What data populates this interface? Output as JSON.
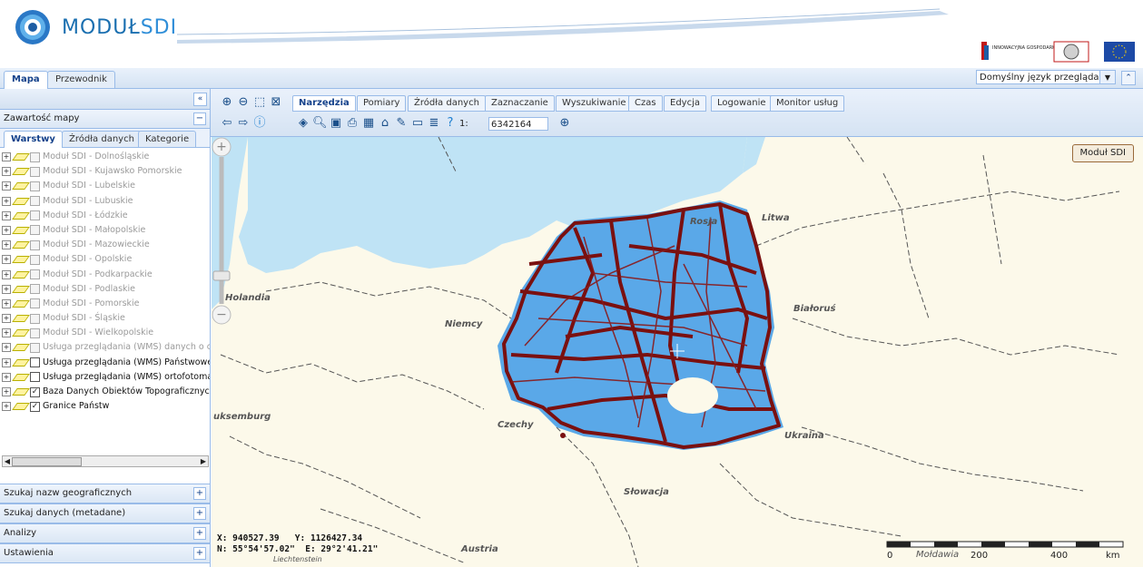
{
  "header": {
    "logo_text_a": "MODUŁ",
    "logo_text_b": "SDI",
    "eu_text": "INNOWACYJNA GOSPODARKA"
  },
  "top_tabs": [
    {
      "label": "Mapa",
      "active": true
    },
    {
      "label": "Przewodnik",
      "active": false
    }
  ],
  "language_select": {
    "value": "Domyślny język przeglądarki"
  },
  "left_panel": {
    "map_contents_title": "Zawartość mapy",
    "subtabs": [
      {
        "label": "Warstwy",
        "active": true
      },
      {
        "label": "Źródła danych",
        "active": false
      },
      {
        "label": "Kategorie",
        "active": false
      }
    ],
    "layers": [
      {
        "label": "Moduł SDI - Dolnośląskie",
        "checked": false,
        "dark": false
      },
      {
        "label": "Moduł SDI - Kujawsko Pomorskie",
        "checked": false,
        "dark": false
      },
      {
        "label": "Moduł SDI - Lubelskie",
        "checked": false,
        "dark": false
      },
      {
        "label": "Moduł SDI - Lubuskie",
        "checked": false,
        "dark": false
      },
      {
        "label": "Moduł SDI - Łódzkie",
        "checked": false,
        "dark": false
      },
      {
        "label": "Moduł SDI - Małopolskie",
        "checked": false,
        "dark": false
      },
      {
        "label": "Moduł SDI - Mazowieckie",
        "checked": false,
        "dark": false
      },
      {
        "label": "Moduł SDI - Opolskie",
        "checked": false,
        "dark": false
      },
      {
        "label": "Moduł SDI - Podkarpackie",
        "checked": false,
        "dark": false
      },
      {
        "label": "Moduł SDI - Podlaskie",
        "checked": false,
        "dark": false
      },
      {
        "label": "Moduł SDI - Pomorskie",
        "checked": false,
        "dark": false
      },
      {
        "label": "Moduł SDI - Śląskie",
        "checked": false,
        "dark": false
      },
      {
        "label": "Moduł SDI - Wielkopolskie",
        "checked": false,
        "dark": false
      },
      {
        "label": "Usługa przeglądania (WMS) danych o ch",
        "checked": false,
        "dark": false
      },
      {
        "label": "Usługa przeglądania (WMS) Państwowe",
        "checked": false,
        "dark": true
      },
      {
        "label": "Usługa przeglądania (WMS) ortofotomap",
        "checked": false,
        "dark": true
      },
      {
        "label": "Baza Danych Obiektów Topograficznych",
        "checked": true,
        "dark": true
      },
      {
        "label": "Granice Państw",
        "checked": true,
        "dark": true
      }
    ],
    "accordion": [
      {
        "label": "Szukaj nazw geograficznych"
      },
      {
        "label": "Szukaj danych (metadane)"
      },
      {
        "label": "Analizy"
      },
      {
        "label": "Ustawienia"
      }
    ]
  },
  "map_tabs": [
    {
      "label": "Narzędzia",
      "active": true
    },
    {
      "label": "Pomiary",
      "active": false
    },
    {
      "label": "Źródła danych",
      "active": false
    },
    {
      "label": "Zaznaczanie",
      "active": false
    },
    {
      "label": "Wyszukiwanie",
      "active": false
    },
    {
      "label": "Czas",
      "active": false
    },
    {
      "label": "Edycja",
      "active": false
    },
    {
      "label": "Logowanie",
      "active": false
    },
    {
      "label": "Monitor usług",
      "active": false
    }
  ],
  "scale": {
    "prefix": "1:",
    "value": "6342164"
  },
  "map": {
    "badge": "Moduł SDI",
    "labels": [
      "Rosja",
      "Litwa",
      "Białoruś",
      "Holandia",
      "Niemcy",
      "Czechy",
      "Ukraina",
      "Słowacja",
      "Austria",
      "Mołdawia",
      "uksemburg",
      "Liechtenstein"
    ],
    "coords_line1": "X: 940527.39   Y: 1126427.34",
    "coords_line2": "N: 55°54'57.02\"  E: 29°2'41.21\"",
    "scalebar": {
      "t0": "0",
      "t1": "200",
      "t2": "400",
      "unit": "km"
    }
  },
  "colors": {
    "accent": "#15428b",
    "border": "#99bbe8",
    "roads": "#7a1010",
    "water": "#bfe3f5"
  }
}
